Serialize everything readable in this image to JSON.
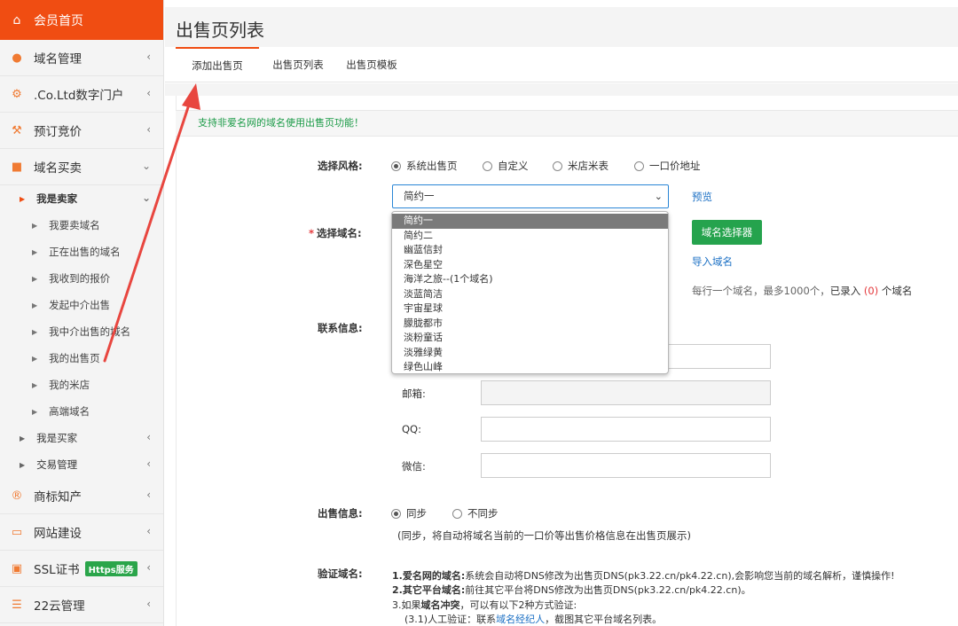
{
  "sidebar": {
    "home": "会员首页",
    "items": [
      {
        "label": "域名管理"
      },
      {
        "label": ".Co.Ltd数字门户"
      },
      {
        "label": "预订竞价"
      },
      {
        "label": "域名买卖"
      }
    ],
    "seller": {
      "label": "我是卖家",
      "items": [
        "我要卖域名",
        "正在出售的域名",
        "我收到的报价",
        "发起中介出售",
        "我中介出售的域名",
        "我的出售页",
        "我的米店",
        "高端域名"
      ]
    },
    "buyer": "我是买家",
    "trade": "交易管理",
    "bottom_items": [
      {
        "label": "商标知产"
      },
      {
        "label": "网站建设"
      },
      {
        "label": "SSL证书",
        "badge": "Https服务"
      },
      {
        "label": "22云管理"
      }
    ]
  },
  "header": {
    "title": "出售页列表"
  },
  "tabs": [
    "添加出售页",
    "出售页列表",
    "出售页模板"
  ],
  "notice": "支持非爱名网的域名使用出售页功能！",
  "form": {
    "style_label": "选择风格:",
    "style_options": [
      "系统出售页",
      "自定义",
      "米店米表",
      "一口价地址"
    ],
    "template_selected": "简约一",
    "preview_link": "预览",
    "template_options": [
      "简约一",
      "简约二",
      "幽蓝信封",
      "深色星空",
      "海洋之旅--(1个域名)",
      "淡蓝简洁",
      "宇宙星球",
      "朦胧都市",
      "淡粉童话",
      "淡雅绿黄",
      "绿色山峰"
    ],
    "domain_label": "选择域名:",
    "domain_selector_button": "域名选择器",
    "import_link": "导入域名",
    "domain_hint_prefix": "每行一个域名，最多1000个，",
    "domain_hint_entered": "已录入",
    "domain_hint_count": "(0)",
    "domain_hint_suffix": "个域名",
    "contact_label": "联系信息:",
    "email_label": "邮箱:",
    "qq_label": "QQ:",
    "wechat_label": "微信:",
    "sale_label": "出售信息:",
    "sale_options": [
      "同步",
      "不同步"
    ],
    "sale_hint": "(同步，将自动将域名当前的一口价等出售价格信息在出售页展示)",
    "verify_label": "验证域名:",
    "verify_1_bold": "1.爱名网的域名:",
    "verify_1_text": "系统会自动将DNS修改为出售页DNS(pk3.22.cn/pk4.22.cn),会影响您当前的域名解析，谨慎操作!",
    "verify_2_bold": "2.其它平台域名:",
    "verify_2_text": "前往其它平台将DNS修改为出售页DNS(pk3.22.cn/pk4.22.cn)。",
    "verify_3_prefix": "3.如果",
    "verify_3_bold": "域名冲突",
    "verify_3_text": "，可以有以下2种方式验证:",
    "verify_31_prefix": "(3.1)人工验证：联系",
    "verify_31_link": "域名经纪人",
    "verify_31_suffix": "，截图其它平台域名列表。"
  },
  "colors": {
    "accent": "#f04d12",
    "green": "#25a34d",
    "link": "#1a6fc4",
    "annotation": "#e8463f"
  }
}
